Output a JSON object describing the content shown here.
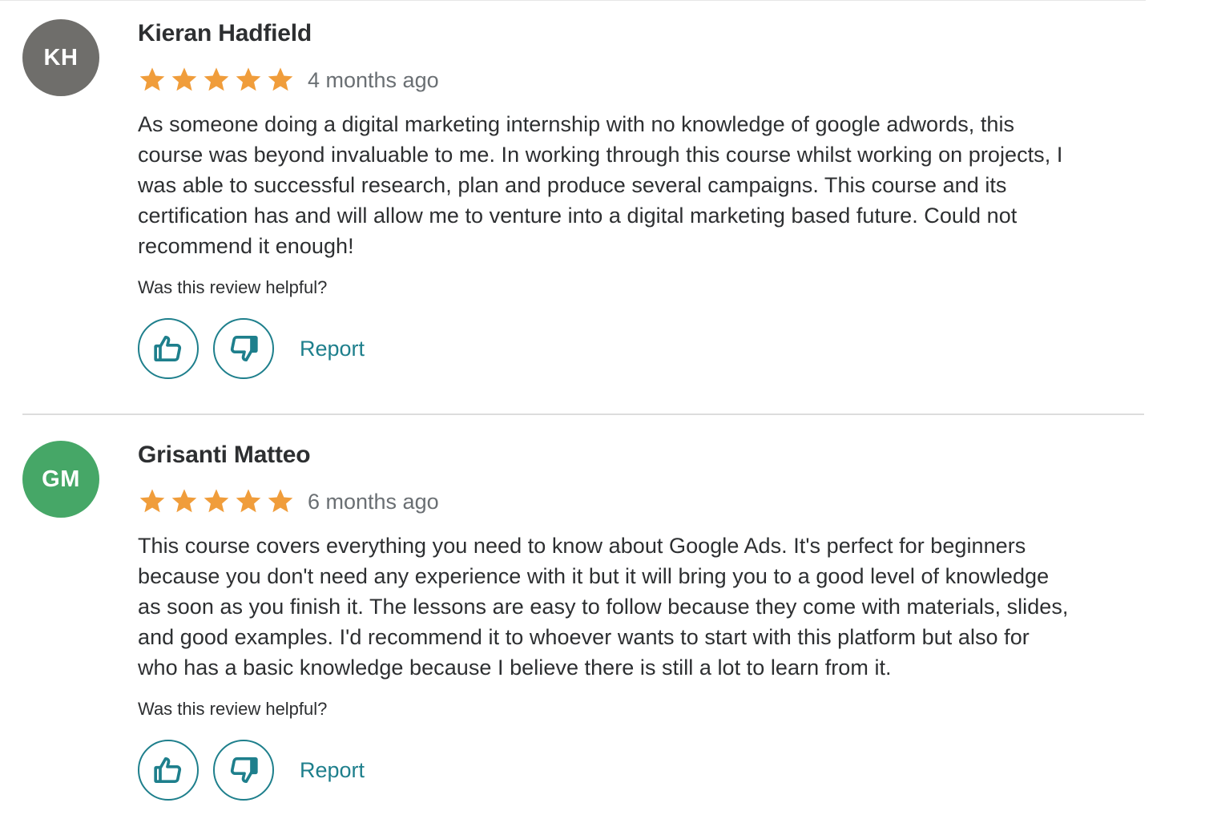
{
  "reviews": [
    {
      "initials": "KH",
      "avatar_color": "#6f6e6b",
      "name": "Kieran Hadfield",
      "rating": 5,
      "rating_max": 5,
      "time_ago": "4 months ago",
      "text_lines": [
        "As someone doing a digital marketing internship with no knowledge of google adwords, this",
        "course was beyond invaluable to me. In working through this course whilst working on projects, I",
        "was able to successful research, plan and produce several campaigns. This course and its",
        "certification has and will allow me to venture into a digital marketing based future. Could not",
        "recommend it enough!"
      ],
      "helpful_label": "Was this review helpful?",
      "report_label": "Report",
      "like_icon": "thumbs-up-icon",
      "dislike_icon": "thumbs-down-icon"
    },
    {
      "initials": "GM",
      "avatar_color": "#46a767",
      "name": "Grisanti Matteo",
      "rating": 5,
      "rating_max": 5,
      "time_ago": "6 months ago",
      "text_lines": [
        "This course covers everything you need to know about Google Ads. It's perfect for beginners",
        "because you don't need any experience with it but it will bring you to a good level of knowledge",
        "as soon as you finish it. The lessons are easy to follow because they come with materials, slides,",
        "and good examples. I'd recommend it to whoever wants to start with this platform but also for",
        "who has a basic knowledge because I believe there is still a lot to learn from it."
      ],
      "helpful_label": "Was this review helpful?",
      "report_label": "Report",
      "like_icon": "thumbs-up-icon",
      "dislike_icon": "thumbs-down-icon"
    }
  ],
  "colors": {
    "star": "#f09d3b",
    "accent": "#1e7f8c",
    "text": "#2d2f31",
    "muted": "#6a6f73",
    "divider": "#dcdcdc"
  }
}
